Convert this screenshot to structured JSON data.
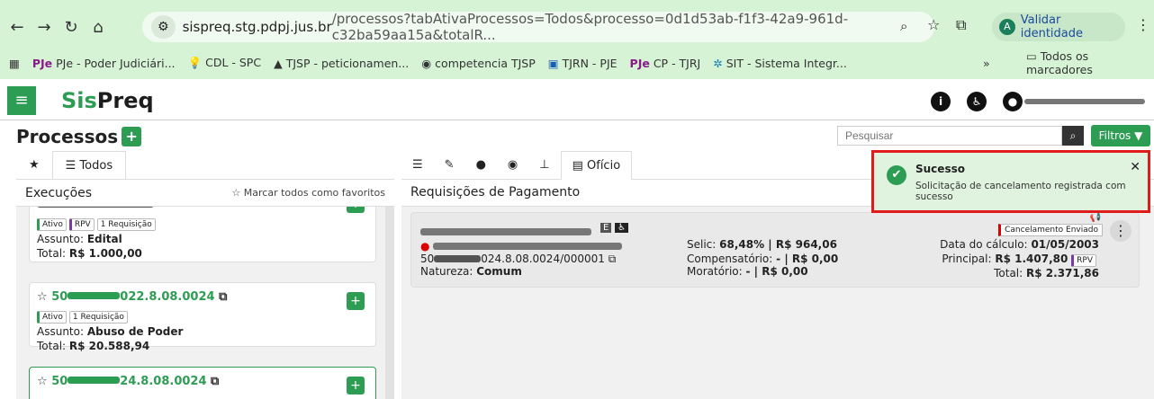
{
  "browser": {
    "url_host": "sispreq.stg.pdpj.jus.br",
    "url_path": "/processos?tabAtivaProcessos=Todos&processo=0d1d53ab-f1f3-42a9-961d-c32ba59aa15a&totalR...",
    "validar_label": "Validar identidade",
    "bookmarks": [
      {
        "label": "PJe - Poder Judiciári..."
      },
      {
        "label": "CDL - SPC"
      },
      {
        "label": "TJSP - peticionamen..."
      },
      {
        "label": "competencia TJSP"
      },
      {
        "label": "TJRN - PJE"
      },
      {
        "label": "CP - TJRJ"
      },
      {
        "label": "SIT - Sistema Integr..."
      }
    ],
    "all_bookmarks_label": "Todos os marcadores"
  },
  "app": {
    "logo_sis": "Sis",
    "logo_preq": "Preq"
  },
  "page": {
    "title": "Processos",
    "search_placeholder": "Pesquisar",
    "filters_label": "Filtros"
  },
  "left": {
    "tab_all": "Todos",
    "header_title": "Execuções",
    "favorite_all": "Marcar todos como favoritos",
    "cards": [
      {
        "badges": [
          "Ativo",
          "RPV",
          "1 Requisição"
        ],
        "assunto_label": "Assunto:",
        "assunto": "Edital",
        "total_label": "Total:",
        "total": "R$ 1.000,00"
      },
      {
        "number_prefix": "50",
        "number_suffix": "022.8.08.0024",
        "badges": [
          "Ativo",
          "1 Requisição"
        ],
        "assunto_label": "Assunto:",
        "assunto": "Abuso de Poder",
        "total_label": "Total:",
        "total": "R$ 20.588,94"
      },
      {
        "number_prefix": "50",
        "number_suffix": "24.8.08.0024"
      }
    ]
  },
  "right": {
    "active_tab": "Ofício",
    "header_title": "Requisições de Pagamento",
    "request": {
      "process_prefix": "50",
      "process_suffix": "024.8.08.0024/000001",
      "natureza_label": "Natureza:",
      "natureza": "Comum",
      "selic_label": "Selic:",
      "selic": "68,48% | R$ 964,06",
      "compensatorio_label": "Compensatório:",
      "compensatorio": "- | R$ 0,00",
      "moratorio_label": "Moratório:",
      "moratorio": "- | R$ 0,00",
      "status": "Cancelamento Enviado",
      "data_calculo_label": "Data do cálculo:",
      "data_calculo": "01/05/2003",
      "principal_label": "Principal:",
      "principal": "R$ 1.407,80",
      "principal_badge": "RPV",
      "total_label": "Total:",
      "total": "R$ 2.371,86"
    }
  },
  "toast": {
    "title": "Sucesso",
    "message": "Solicitação de cancelamento registrada com sucesso"
  }
}
